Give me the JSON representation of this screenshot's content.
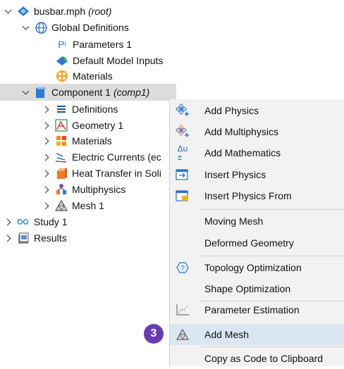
{
  "tree": {
    "root_name": "busbar.mph",
    "root_tag": "(root)",
    "global_definitions": "Global Definitions",
    "parameters": "Parameters 1",
    "default_model_inputs": "Default Model Inputs",
    "materials_global": "Materials",
    "component_name": "Component 1",
    "component_tag": "(comp1)",
    "definitions": "Definitions",
    "geometry": "Geometry 1",
    "materials": "Materials",
    "electric_currents": "Electric Currents (ec",
    "heat_transfer": "Heat Transfer in Soli",
    "multiphysics": "Multiphysics",
    "mesh": "Mesh 1",
    "study": "Study 1",
    "results": "Results"
  },
  "context_menu": {
    "add_physics": "Add Physics",
    "add_multiphysics": "Add Multiphysics",
    "add_mathematics": "Add Mathematics",
    "insert_physics": "Insert Physics",
    "insert_physics_from": "Insert Physics From",
    "moving_mesh": "Moving Mesh",
    "deformed_geometry": "Deformed Geometry",
    "topology_optimization": "Topology Optimization",
    "shape_optimization": "Shape Optimization",
    "parameter_estimation": "Parameter Estimation",
    "add_mesh": "Add Mesh",
    "copy_as_code": "Copy as Code to Clipboard"
  },
  "step_badge": "3",
  "colors": {
    "selection": "#dcdcdc",
    "menu_bg": "#f2f2f2",
    "menu_highlight": "#dbe6f3",
    "badge": "#6a3cb2"
  }
}
